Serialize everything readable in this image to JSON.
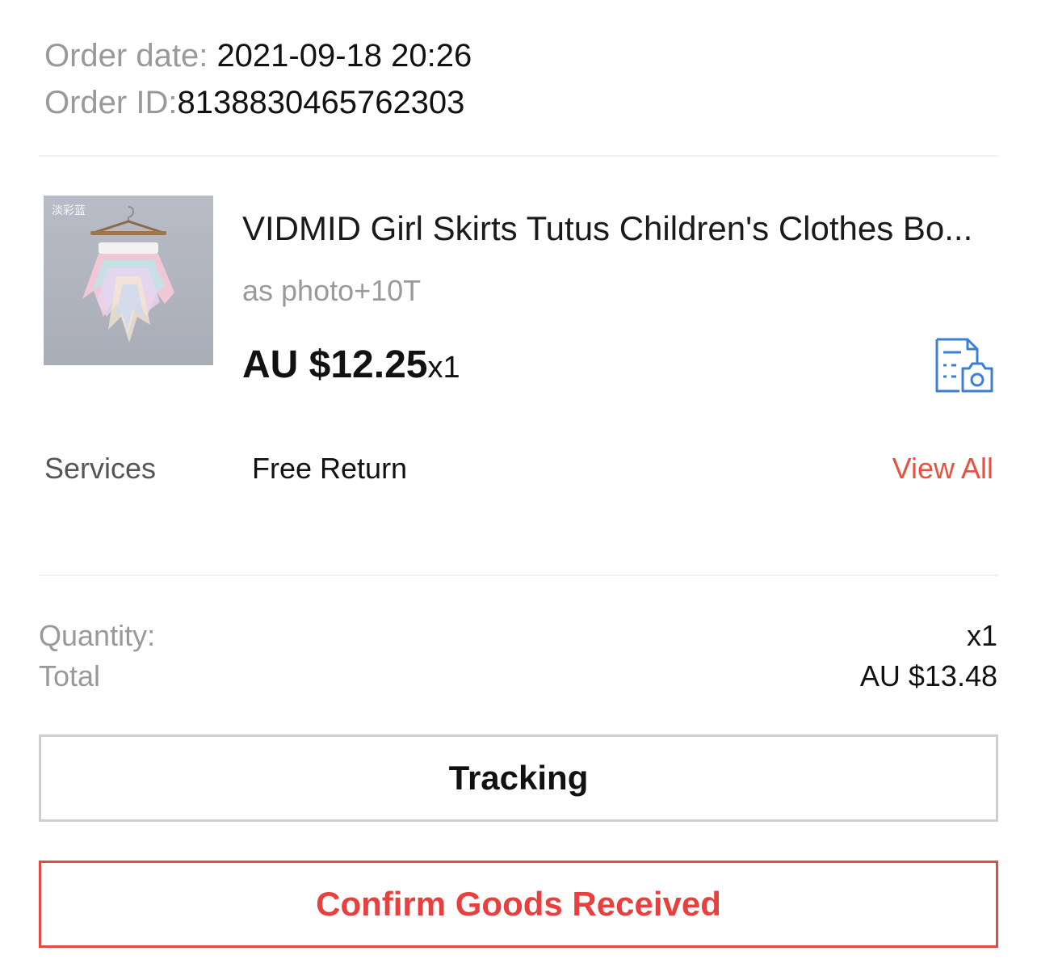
{
  "order": {
    "date_label": "Order date: ",
    "date_value": "2021-09-18 20:26",
    "id_label": "Order ID:",
    "id_value": "8138830465762303"
  },
  "product": {
    "thumbnail_watermark": "淡彩蓝",
    "title": "VIDMID Girl Skirts Tutus Children's Clothes Bo...",
    "variant": "as photo+10T",
    "price": "AU $12.25",
    "quantity_inline": "x1",
    "photo_review_icon": "receipt-camera-icon"
  },
  "services": {
    "label": "Services",
    "value": "Free Return",
    "view_all": "View All"
  },
  "summary": {
    "quantity_label": "Quantity:",
    "quantity_value": "x1",
    "total_label": "Total",
    "total_value": "AU $13.48"
  },
  "actions": {
    "tracking": "Tracking",
    "confirm": "Confirm Goods Received"
  },
  "colors": {
    "accent_red": "#e8403e",
    "link_red": "#e8513e",
    "icon_blue": "#3b7fd4",
    "label_grey": "#999999"
  }
}
